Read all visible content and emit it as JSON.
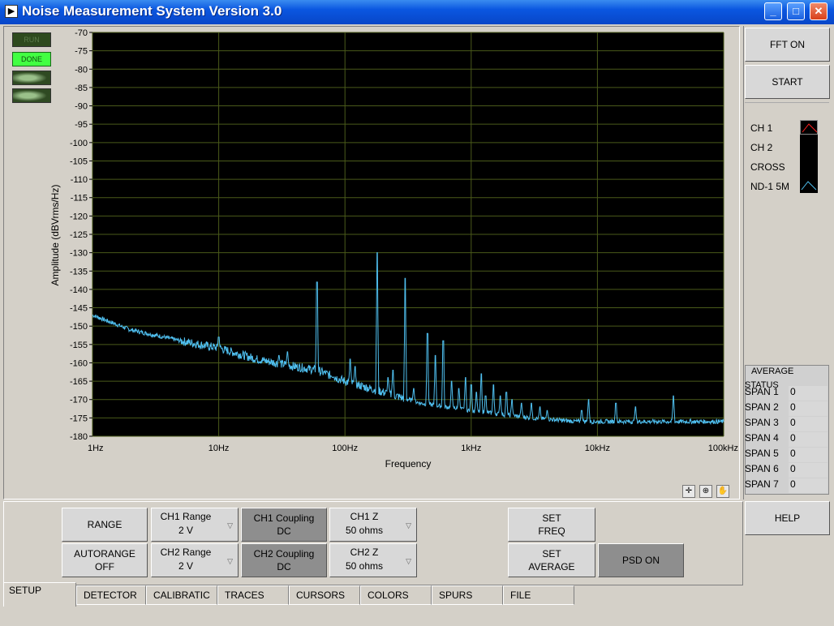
{
  "window": {
    "title": "Noise Measurement System Version 3.0",
    "app_icon": "labview-icon",
    "minimize": "_",
    "maximize": "□",
    "close": "✕"
  },
  "indicators": {
    "run": "RUN",
    "done": "DONE"
  },
  "graph": {
    "ylabel": "Amplitude (dBVrms/Hz)",
    "xlabel": "Frequency",
    "background": "#000000",
    "grid_color": "#4a5a1a",
    "trace_color": "#4fbfef"
  },
  "chart_data": {
    "type": "line",
    "xlabel": "Frequency",
    "ylabel": "Amplitude (dBVrms/Hz)",
    "x_scale": "log",
    "xlim": [
      1,
      100000
    ],
    "ylim": [
      -180,
      -70
    ],
    "yticks": [
      -70,
      -75,
      -80,
      -85,
      -90,
      -95,
      -100,
      -105,
      -110,
      -115,
      -120,
      -125,
      -130,
      -135,
      -140,
      -145,
      -150,
      -155,
      -160,
      -165,
      -170,
      -175,
      -180
    ],
    "xticks": [
      {
        "value": 1,
        "label": "1Hz"
      },
      {
        "value": 10,
        "label": "10Hz"
      },
      {
        "value": 100,
        "label": "100Hz"
      },
      {
        "value": 1000,
        "label": "1kHz"
      },
      {
        "value": 10000,
        "label": "10kHz"
      },
      {
        "value": 100000,
        "label": "100kHz"
      }
    ],
    "grid": true,
    "series": [
      {
        "name": "ND-1 5M",
        "color": "#4fbfef",
        "baseline": [
          [
            1,
            -147
          ],
          [
            2,
            -151
          ],
          [
            5,
            -154
          ],
          [
            10,
            -156
          ],
          [
            20,
            -159
          ],
          [
            40,
            -161
          ],
          [
            60,
            -162
          ],
          [
            100,
            -165
          ],
          [
            200,
            -168
          ],
          [
            400,
            -171
          ],
          [
            1000,
            -173
          ],
          [
            3000,
            -175
          ],
          [
            7000,
            -176
          ],
          [
            20000,
            -176
          ],
          [
            100000,
            -176
          ]
        ],
        "peaks": [
          [
            10,
            -153
          ],
          [
            30,
            -158
          ],
          [
            35,
            -157
          ],
          [
            60,
            -138
          ],
          [
            70,
            -163
          ],
          [
            80,
            -164
          ],
          [
            110,
            -159
          ],
          [
            120,
            -161
          ],
          [
            180,
            -130
          ],
          [
            220,
            -164
          ],
          [
            240,
            -162
          ],
          [
            300,
            -137
          ],
          [
            350,
            -167
          ],
          [
            450,
            -152
          ],
          [
            520,
            -158
          ],
          [
            600,
            -154
          ],
          [
            700,
            -165
          ],
          [
            800,
            -167
          ],
          [
            900,
            -164
          ],
          [
            1000,
            -166
          ],
          [
            1100,
            -168
          ],
          [
            1200,
            -163
          ],
          [
            1300,
            -169
          ],
          [
            1500,
            -166
          ],
          [
            1700,
            -169
          ],
          [
            1900,
            -168
          ],
          [
            2100,
            -170
          ],
          [
            2500,
            -171
          ],
          [
            3000,
            -171
          ],
          [
            3500,
            -172
          ],
          [
            4000,
            -173
          ],
          [
            7500,
            -173
          ],
          [
            8500,
            -170
          ],
          [
            14000,
            -171
          ],
          [
            20000,
            -172
          ],
          [
            40000,
            -169
          ]
        ]
      }
    ]
  },
  "right": {
    "fft_button": "FFT ON",
    "start_button": "START",
    "legend": [
      {
        "label": "CH 1",
        "color": "#ff2020"
      },
      {
        "label": "CH 2",
        "color": ""
      },
      {
        "label": "CROSS",
        "color": ""
      },
      {
        "label": "ND-1 5M",
        "color": "#4fbfef"
      }
    ],
    "average_title": "AVERAGE",
    "status_label": "STATUS",
    "spans": [
      {
        "label": "SPAN 1",
        "value": "0"
      },
      {
        "label": "SPAN 2",
        "value": "0"
      },
      {
        "label": "SPAN 3",
        "value": "0"
      },
      {
        "label": "SPAN 4",
        "value": "0"
      },
      {
        "label": "SPAN 5",
        "value": "0"
      },
      {
        "label": "SPAN 6",
        "value": "0"
      },
      {
        "label": "SPAN 7",
        "value": "0"
      }
    ],
    "help_button": "HELP"
  },
  "controls": {
    "range_button": "RANGE",
    "autorange_line1": "AUTORANGE",
    "autorange_line2": "OFF",
    "ch1_range_label": "CH1 Range",
    "ch1_range_value": "2 V",
    "ch2_range_label": "CH2 Range",
    "ch2_range_value": "2 V",
    "ch1_coupling_line1": "CH1 Coupling",
    "ch1_coupling_line2": "DC",
    "ch2_coupling_line1": "CH2 Coupling",
    "ch2_coupling_line2": "DC",
    "ch1_z_label": "CH1 Z",
    "ch1_z_value": "50 ohms",
    "ch2_z_label": "CH2 Z",
    "ch2_z_value": "50 ohms",
    "set_freq_line1": "SET",
    "set_freq_line2": "FREQ",
    "set_avg_line1": "SET",
    "set_avg_line2": "AVERAGE",
    "psd_button": "PSD ON"
  },
  "tabs": [
    "SETUP",
    "DETECTOR",
    "CALIBRATIC",
    "TRACES",
    "CURSORS",
    "COLORS",
    "SPURS",
    "FILE"
  ],
  "graph_tools": [
    "crosshair-icon",
    "zoom-icon",
    "pan-hand-icon"
  ]
}
